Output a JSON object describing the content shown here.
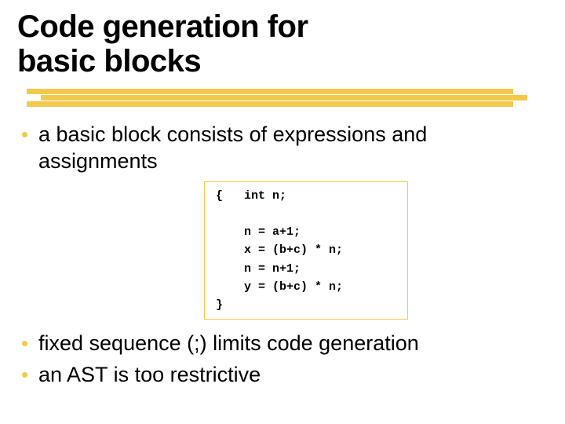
{
  "title_line1": "Code generation for",
  "title_line2": "basic blocks",
  "bullets": {
    "b1": "a basic block consists of expressions and assignments",
    "b2": "fixed sequence (;) limits code generation",
    "b3": "an AST is too restrictive"
  },
  "code": "{   int n;\n\n    n = a+1;\n    x = (b+c) * n;\n    n = n+1;\n    y = (b+c) * n;\n}",
  "colors": {
    "accent": "#f2c94c"
  }
}
